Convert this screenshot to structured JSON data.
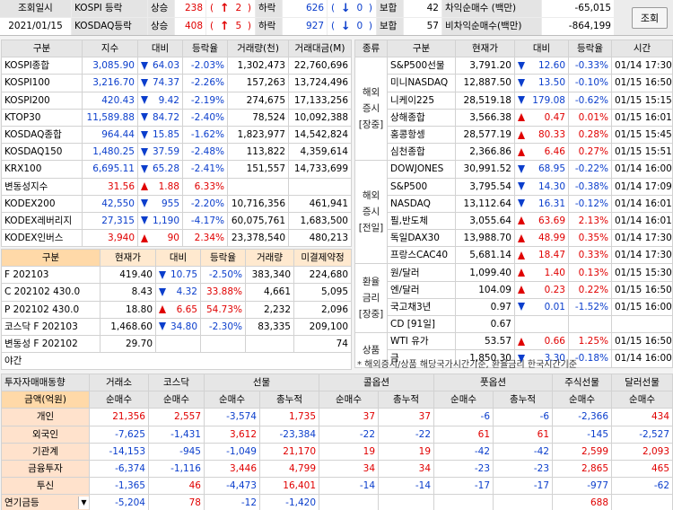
{
  "header": {
    "date_label": "조회일시",
    "date_value": "2021/01/15",
    "rows": [
      {
        "name": "KOSPI 등락",
        "up_label": "상승",
        "up": "238",
        "upper": "2",
        "down_label": "하락",
        "down": "626",
        "lower": "0",
        "flat_label": "보합",
        "flat": "42"
      },
      {
        "name": "KOSDAQ등락",
        "up_label": "상승",
        "up": "408",
        "upper": "5",
        "down_label": "하락",
        "down": "927",
        "lower": "0",
        "flat_label": "보합",
        "flat": "57"
      }
    ],
    "arb_label": "차익순매수 (백만)",
    "arb_value": "-65,015",
    "nonarb_label": "비차익순매수(백만)",
    "nonarb_value": "-864,199",
    "query_button": "조회"
  },
  "indices": {
    "headers": [
      "구분",
      "지수",
      "대비",
      "등락율",
      "거래량(천)",
      "거래대금(M)"
    ],
    "rows": [
      {
        "name": "KOSPI종합",
        "value": "3,085.90",
        "dir": "down",
        "change": "64.03",
        "rate": "-2.03%",
        "volume": "1,302,473",
        "amount": "22,760,696"
      },
      {
        "name": "KOSPI100",
        "value": "3,216.70",
        "dir": "down",
        "change": "74.37",
        "rate": "-2.26%",
        "volume": "157,263",
        "amount": "13,724,496"
      },
      {
        "name": "KOSPI200",
        "value": "420.43",
        "dir": "down",
        "change": "9.42",
        "rate": "-2.19%",
        "volume": "274,675",
        "amount": "17,133,256"
      },
      {
        "name": "KTOP30",
        "value": "11,589.88",
        "dir": "down",
        "change": "84.72",
        "rate": "-2.40%",
        "volume": "78,524",
        "amount": "10,092,388"
      },
      {
        "name": "KOSDAQ종합",
        "value": "964.44",
        "dir": "down",
        "change": "15.85",
        "rate": "-1.62%",
        "volume": "1,823,977",
        "amount": "14,542,824"
      },
      {
        "name": "KOSDAQ150",
        "value": "1,480.25",
        "dir": "down",
        "change": "37.59",
        "rate": "-2.48%",
        "volume": "113,822",
        "amount": "4,359,614"
      },
      {
        "name": "KRX100",
        "value": "6,695.11",
        "dir": "down",
        "change": "65.28",
        "rate": "-2.41%",
        "volume": "151,557",
        "amount": "14,733,699"
      },
      {
        "name": "변동성지수",
        "value": "31.56",
        "dir": "up",
        "change": "1.88",
        "rate": "6.33%",
        "volume": "",
        "amount": ""
      },
      {
        "name": "KODEX200",
        "value": "42,550",
        "dir": "down",
        "change": "955",
        "rate": "-2.20%",
        "volume": "10,716,356",
        "amount": "461,941"
      },
      {
        "name": "KODEX레버리지",
        "value": "27,315",
        "dir": "down",
        "change": "1,190",
        "rate": "-4.17%",
        "volume": "60,075,761",
        "amount": "1,683,500"
      },
      {
        "name": "KODEX인버스",
        "value": "3,940",
        "dir": "up",
        "change": "90",
        "rate": "2.34%",
        "volume": "23,378,540",
        "amount": "480,213"
      }
    ]
  },
  "futures": {
    "headers": [
      "구분",
      "현재가",
      "대비",
      "등락율",
      "거래량",
      "미결제약정"
    ],
    "rows": [
      {
        "name": "F 202103",
        "value": "419.40",
        "dir": "down",
        "change": "10.75",
        "rate": "-2.50%",
        "volume": "383,340",
        "oi": "224,680"
      },
      {
        "name": "C 202102 430.0",
        "value": "8.43",
        "dir": "down",
        "change": "4.32",
        "rate": "33.88%",
        "volume": "4,661",
        "oi": "5,095"
      },
      {
        "name": "P 202102 430.0",
        "value": "18.80",
        "dir": "up",
        "change": "6.65",
        "rate": "54.73%",
        "volume": "2,232",
        "oi": "2,096"
      },
      {
        "name": "코스닥 F 202103",
        "value": "1,468.60",
        "dir": "down",
        "change": "34.80",
        "rate": "-2.30%",
        "volume": "83,335",
        "oi": "209,100"
      },
      {
        "name": "변동성 F 202102",
        "value": "29.70",
        "dir": "",
        "change": "",
        "rate": "",
        "volume": "",
        "oi": "74"
      }
    ],
    "footer": "야간"
  },
  "world": {
    "headers": [
      "종류",
      "구분",
      "현재가",
      "대비",
      "등락율",
      "시간"
    ],
    "groups": [
      {
        "label": "해외\n증시\n[장중]",
        "rows": [
          {
            "name": "S&P500선물",
            "value": "3,791.20",
            "dir": "down",
            "change": "12.60",
            "rate": "-0.33%",
            "time": "01/14 17:30"
          },
          {
            "name": "미니NASDAQ",
            "value": "12,887.50",
            "dir": "down",
            "change": "13.50",
            "rate": "-0.10%",
            "time": "01/15 16:50"
          },
          {
            "name": "니케이225",
            "value": "28,519.18",
            "dir": "down",
            "change": "179.08",
            "rate": "-0.62%",
            "time": "01/15 15:15"
          },
          {
            "name": "상해종합",
            "value": "3,566.38",
            "dir": "up",
            "change": "0.47",
            "rate": "0.01%",
            "time": "01/15 16:01"
          },
          {
            "name": "홍콩항셍",
            "value": "28,577.19",
            "dir": "up",
            "change": "80.33",
            "rate": "0.28%",
            "time": "01/15 15:45"
          },
          {
            "name": "심천종합",
            "value": "2,366.86",
            "dir": "up",
            "change": "6.46",
            "rate": "0.27%",
            "time": "01/15 15:51"
          }
        ]
      },
      {
        "label": "해외\n증시\n[전일]",
        "rows": [
          {
            "name": "DOWJONES",
            "value": "30,991.52",
            "dir": "down",
            "change": "68.95",
            "rate": "-0.22%",
            "time": "01/14 16:00"
          },
          {
            "name": "S&P500",
            "value": "3,795.54",
            "dir": "down",
            "change": "14.30",
            "rate": "-0.38%",
            "time": "01/14 17:09"
          },
          {
            "name": "NASDAQ",
            "value": "13,112.64",
            "dir": "down",
            "change": "16.31",
            "rate": "-0.12%",
            "time": "01/14 16:01"
          },
          {
            "name": "필,반도체",
            "value": "3,055.64",
            "dir": "up",
            "change": "63.69",
            "rate": "2.13%",
            "time": "01/14 16:01"
          },
          {
            "name": "독일DAX30",
            "value": "13,988.70",
            "dir": "up",
            "change": "48.99",
            "rate": "0.35%",
            "time": "01/14 17:30"
          },
          {
            "name": "프랑스CAC40",
            "value": "5,681.14",
            "dir": "up",
            "change": "18.47",
            "rate": "0.33%",
            "time": "01/14 17:30"
          }
        ]
      },
      {
        "label": "환율\n금리\n[장중]",
        "rows": [
          {
            "name": "원/달러",
            "value": "1,099.40",
            "dir": "up",
            "change": "1.40",
            "rate": "0.13%",
            "time": "01/15 15:30"
          },
          {
            "name": "엔/달러",
            "value": "104.09",
            "dir": "up",
            "change": "0.23",
            "rate": "0.22%",
            "time": "01/15 16:50"
          },
          {
            "name": "국고채3년",
            "value": "0.97",
            "dir": "down",
            "change": "0.01",
            "rate": "-1.52%",
            "time": "01/15 16:00"
          },
          {
            "name": "CD [91일]",
            "value": "0.67",
            "dir": "",
            "change": "",
            "rate": "",
            "time": ""
          }
        ]
      },
      {
        "label": "상품",
        "rows": [
          {
            "name": "WTI 유가",
            "value": "53.57",
            "dir": "up",
            "change": "0.66",
            "rate": "1.25%",
            "time": "01/15 16:50"
          },
          {
            "name": "금",
            "value": "1,850.30",
            "dir": "down",
            "change": "3.30",
            "rate": "-0.18%",
            "time": "01/14 16:00"
          }
        ]
      }
    ],
    "note": "* 해외증시/상품 해당국가시간기준, 환율금리 한국시간기준"
  },
  "flows": {
    "top_headers": [
      "투자자매매동향",
      "거래소",
      "코스닥",
      "선물",
      "",
      "콜옵션",
      "",
      "풋옵션",
      "",
      "주식선물",
      "달러선물"
    ],
    "sub_headers": [
      "금액(억원)",
      "순매수",
      "순매수",
      "순매수",
      "총누적",
      "순매수",
      "총누적",
      "순매수",
      "총누적",
      "순매수",
      "순매수"
    ],
    "rows": [
      {
        "name": "개인",
        "cells": [
          "21,356",
          "2,557",
          "-3,574",
          "1,735",
          "37",
          "37",
          "-6",
          "-6",
          "-2,366",
          "434"
        ]
      },
      {
        "name": "외국인",
        "cells": [
          "-7,625",
          "-1,431",
          "3,612",
          "-23,384",
          "-22",
          "-22",
          "61",
          "61",
          "-145",
          "-2,527"
        ]
      },
      {
        "name": "기관계",
        "cells": [
          "-14,153",
          "-945",
          "-1,049",
          "21,170",
          "19",
          "19",
          "-42",
          "-42",
          "2,599",
          "2,093"
        ]
      },
      {
        "name": "금융투자",
        "cells": [
          "-6,374",
          "-1,116",
          "3,446",
          "4,799",
          "34",
          "34",
          "-23",
          "-23",
          "2,865",
          "465"
        ]
      },
      {
        "name": "투신",
        "cells": [
          "-1,365",
          "46",
          "-4,473",
          "16,401",
          "-14",
          "-14",
          "-17",
          "-17",
          "-977",
          "-62"
        ]
      },
      {
        "name": "연기금등",
        "cells": [
          "-5,204",
          "78",
          "-12",
          "-1,420",
          "",
          "",
          "",
          "",
          "688",
          ""
        ]
      }
    ]
  },
  "colors": {
    "accent": "#ffd9a8",
    "up": "#e00000",
    "down": "#0b3ecc"
  }
}
